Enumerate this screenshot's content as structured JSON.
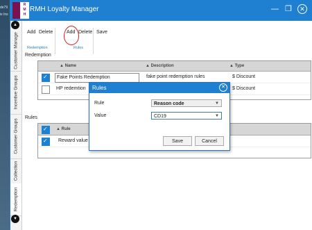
{
  "background": {
    "lines": [
      "de79",
      "ix Ins"
    ]
  },
  "window": {
    "title": "RMH Loyalty Manager",
    "logo_letters": [
      "R",
      "M",
      "H"
    ],
    "minimize_glyph": "—",
    "restore_glyph": "❐",
    "close_glyph": "✕"
  },
  "side_tabs": [
    "Customer Manage",
    "Incentive Groups",
    "Customer Groups",
    "Collection",
    "Redemption"
  ],
  "side_scroll": {
    "up": "▲",
    "down": "▼"
  },
  "ribbon": {
    "buttons": [
      "Add",
      "Delete",
      "Add",
      "Delete",
      "Save"
    ],
    "groups": [
      "Redemption",
      "Rules"
    ]
  },
  "redemption": {
    "label": "Redemption",
    "columns": [
      "Name",
      "Description",
      "Type"
    ],
    "rows": [
      {
        "checked": true,
        "name": "Fake Points Redemption",
        "description": "fake point redemption rules",
        "type": "$ Discount"
      },
      {
        "checked": false,
        "name": "HP redemtion",
        "description": "",
        "type": "$ Discount"
      }
    ]
  },
  "rules": {
    "label": "Rules",
    "columns": [
      "Rule"
    ],
    "rows": [
      {
        "checked": true,
        "rule": "Reward value per poir"
      }
    ]
  },
  "dialog": {
    "title": "Rules",
    "close_glyph": "✕",
    "rule_label": "Rule",
    "rule_value": "Reason code",
    "value_label": "Value",
    "value_value": "CD19",
    "save": "Save",
    "cancel": "Cancel"
  },
  "colors": {
    "accent": "#1f7fd0",
    "annotation": "#d32020",
    "brand": "#7b1150"
  }
}
